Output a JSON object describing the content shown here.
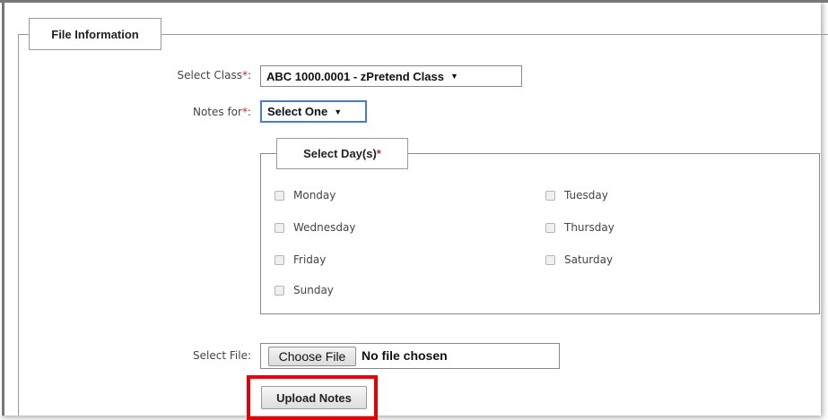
{
  "fieldset": {
    "legend": "File Information"
  },
  "select_class": {
    "label": "Select Class",
    "required_mark": "*",
    "colon": ":",
    "value": "ABC 1000.0001 - zPretend Class"
  },
  "notes_for": {
    "label": "Notes for",
    "required_mark": "*",
    "colon": ":",
    "value": "Select One"
  },
  "days": {
    "legend": "Select Day(s)",
    "required_mark": "*",
    "items": [
      {
        "label": "Monday",
        "checked": false
      },
      {
        "label": "Tuesday",
        "checked": false
      },
      {
        "label": "Wednesday",
        "checked": false
      },
      {
        "label": "Thursday",
        "checked": false
      },
      {
        "label": "Friday",
        "checked": false
      },
      {
        "label": "Saturday",
        "checked": false
      },
      {
        "label": "Sunday",
        "checked": false
      }
    ]
  },
  "select_file": {
    "label": "Select File:",
    "button_label": "Choose File",
    "status": "No file chosen"
  },
  "upload": {
    "button_label": "Upload Notes"
  },
  "colors": {
    "required": "#c62828",
    "highlight": "#e60000",
    "focus": "#4a7bd0"
  },
  "icons": {
    "dropdown_arrow": "▼"
  }
}
